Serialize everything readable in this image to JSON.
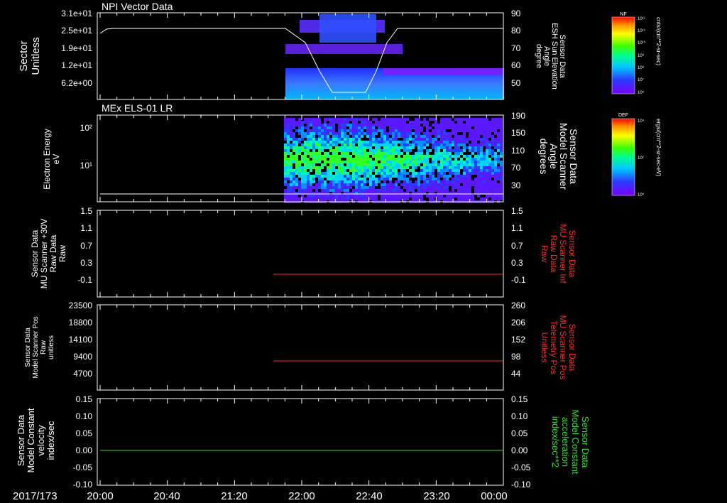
{
  "date_label": "2017/173",
  "time_ticks": [
    "20:00",
    "20:40",
    "21:20",
    "22:00",
    "22:40",
    "23:20",
    "00:00"
  ],
  "colors": {
    "red": "#ff2a2a",
    "green": "#33dd33",
    "white": "#ffffff"
  },
  "panels": [
    {
      "title": "NPI Vector Data",
      "left_label": [
        "Sector",
        "Unitless"
      ],
      "left_ticks": [
        "3.1e+01",
        "2.5e+01",
        "1.9e+01",
        "1.2e+01",
        "6.2e+00"
      ],
      "right_label": [
        "Sensor Data",
        "ESH Sun Elevation",
        "Angle",
        "degree"
      ],
      "right_ticks": [
        "90",
        "80",
        "70",
        "60",
        "50"
      ]
    },
    {
      "title": "MEx ELS-01 LR",
      "left_label": [
        "Electron Energy",
        "eV"
      ],
      "left_ticks": [
        "10²",
        "10¹"
      ],
      "right_label": [
        "Sensor Data",
        "Model Scanner",
        "Angle",
        "degrees"
      ],
      "right_ticks": [
        "190",
        "150",
        "110",
        "70",
        "30"
      ]
    },
    {
      "title": "",
      "left_label": [
        "Sensor Data",
        "MU Scanner +30V",
        "Raw Data",
        "Raw"
      ],
      "left_ticks": [
        "1.5",
        "1.1",
        "0.7",
        "0.3",
        "-0.1"
      ],
      "right_label": [
        "Sensor Data",
        "MU Scanner Inf",
        "Raw Data",
        "Raw"
      ],
      "right_ticks": [
        "1.5",
        "1.1",
        "0.7",
        "0.3",
        "-0.1"
      ]
    },
    {
      "title": "",
      "left_label": [
        "Sensor Data",
        "Model Scanner Pos",
        "Raw",
        "unitless"
      ],
      "left_ticks": [
        "23500",
        "18800",
        "14100",
        "9400",
        "4700"
      ],
      "right_label": [
        "Sensor Data",
        "MU Scanner Pos",
        "Telemetry Pos",
        "Unitless"
      ],
      "right_ticks": [
        "260",
        "206",
        "152",
        "98",
        "44"
      ]
    },
    {
      "title": "",
      "left_label": [
        "Sensor Data",
        "Model Constant",
        "velocity",
        "index/sec"
      ],
      "left_ticks": [
        "0.15",
        "0.10",
        "0.05",
        "0.00",
        "-0.05",
        "-0.10"
      ],
      "right_label": [
        "Sensor Data",
        "Model Constant",
        "acceleration",
        "index/sec**2"
      ],
      "right_ticks": [
        "0.15",
        "0.10",
        "0.05",
        "0.00",
        "-0.05",
        "-0.10"
      ]
    }
  ],
  "colorbars": [
    {
      "tag": "NF",
      "unit": "cnts/(cm**2-sr-sec)",
      "ticks": [
        "10¹²",
        "10¹¹",
        "10¹⁰",
        "10⁹",
        "10⁸",
        "10⁷",
        "10⁶"
      ]
    },
    {
      "tag": "DEF",
      "unit": "ergs/(cm**2-sr-sec-eV)",
      "ticks": [
        "10⁴",
        "10²",
        "10⁰"
      ]
    }
  ],
  "chart_data": [
    {
      "type": "heatmap",
      "title": "NPI Vector Data",
      "x_range": [
        "20:00",
        "00:00"
      ],
      "ylabel": "Sector Unitless",
      "ylim": [
        0,
        31
      ],
      "y2label": "Sensor Data ESH Sun Elevation Angle degree",
      "y2lim": [
        40,
        90
      ],
      "series": [
        {
          "name": "ESH Sun Elevation Angle",
          "x": [
            "20:00",
            "20:05",
            "21:10",
            "22:00",
            "22:25",
            "22:35",
            "22:50",
            "23:20",
            "00:00"
          ],
          "values": [
            78,
            80,
            80,
            80,
            44,
            44,
            80,
            80,
            80
          ]
        }
      ],
      "data_start": "21:50"
    },
    {
      "type": "heatmap",
      "title": "MEx ELS-01 LR",
      "x_range": [
        "20:00",
        "00:00"
      ],
      "ylabel": "Electron Energy eV",
      "y_scale": "log",
      "y2label": "Sensor Data Model Scanner Angle degrees",
      "y2lim": [
        10,
        190
      ],
      "series": [
        {
          "name": "Model Scanner Angle",
          "x": [
            "20:00",
            "00:00"
          ],
          "values": [
            17,
            17
          ]
        }
      ],
      "data_start": "21:50"
    },
    {
      "type": "line",
      "x_range": [
        "20:00",
        "00:00"
      ],
      "ylim": [
        -0.3,
        1.5
      ],
      "series": [
        {
          "name": "MU Scanner Inf",
          "color": "#ff2a2a",
          "x": [
            "21:40",
            "00:00"
          ],
          "values": [
            0.05,
            0.05
          ]
        }
      ]
    },
    {
      "type": "line",
      "x_range": [
        "20:00",
        "00:00"
      ],
      "ylim": [
        0,
        23500
      ],
      "y2lim": [
        0,
        260
      ],
      "series": [
        {
          "name": "MU Scanner Pos",
          "color": "#ff2a2a",
          "x": [
            "21:40",
            "00:00"
          ],
          "values_right": [
            90,
            90
          ]
        }
      ]
    },
    {
      "type": "line",
      "x_range": [
        "20:00",
        "00:00"
      ],
      "ylim": [
        -0.1,
        0.15
      ],
      "series": [
        {
          "name": "Model Constant velocity",
          "color": "#33dd33",
          "x": [
            "20:00",
            "00:00"
          ],
          "values": [
            0.0,
            0.0
          ]
        }
      ]
    }
  ]
}
